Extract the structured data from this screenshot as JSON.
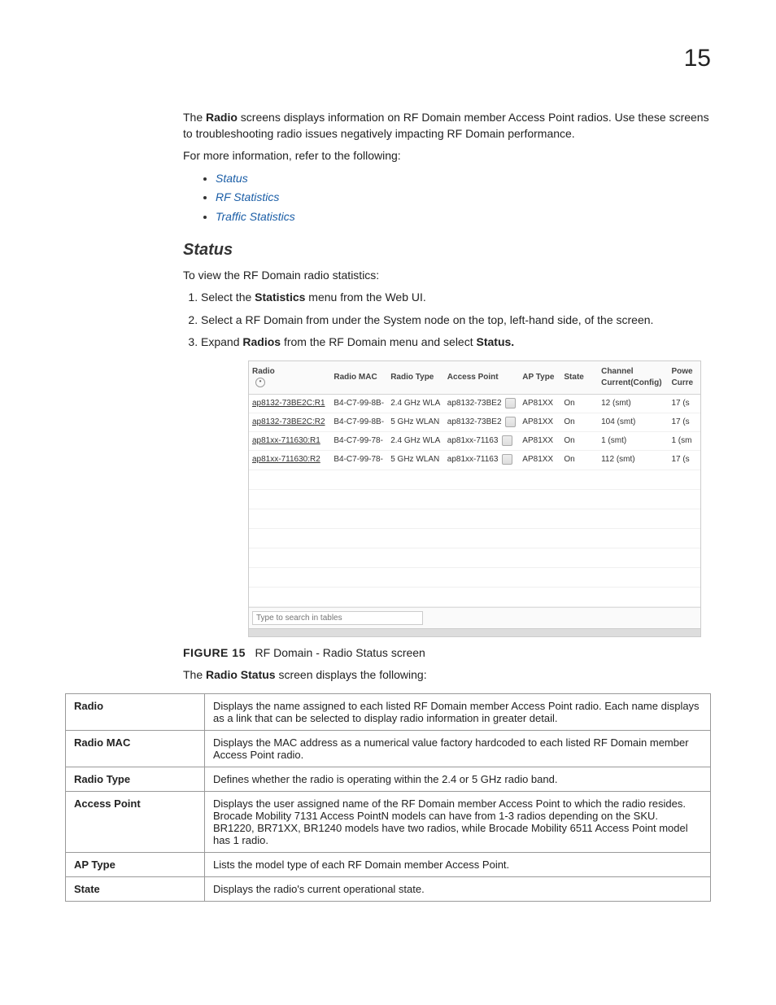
{
  "page_number": "15",
  "intro": {
    "radio_label": "Radio",
    "text1": " screens displays information on RF Domain member Access Point radios. Use these screens to troubleshooting radio issues negatively impacting RF Domain performance.",
    "text2": "For more information, refer to the following:"
  },
  "links": [
    "Status",
    "RF Statistics",
    "Traffic Statistics"
  ],
  "status_heading": "Status",
  "status_intro": "To view the RF Domain radio statistics:",
  "steps": {
    "s1a": "Select the ",
    "s1b": "Statistics",
    "s1c": " menu from the Web UI.",
    "s2": "Select a RF Domain from under the System node on the top, left-hand side, of the screen.",
    "s3a": "Expand ",
    "s3b": "Radios",
    "s3c": " from the RF Domain menu and select ",
    "s3d": "Status.",
    "s3e": ""
  },
  "screenshot": {
    "headers": {
      "radio": "Radio",
      "mac": "Radio MAC",
      "type": "Radio Type",
      "ap": "Access Point",
      "aptype": "AP Type",
      "state": "State",
      "channel": "Channel Current(Config)",
      "power": "Powe Curre"
    },
    "rows": [
      {
        "radio": "ap8132-73BE2C:R1",
        "mac": "B4-C7-99-8B-",
        "type": "2.4 GHz WLA",
        "ap": "ap8132-73BE2",
        "aptype": "AP81XX",
        "state": "On",
        "channel": "12 (smt)",
        "power": "17 (s"
      },
      {
        "radio": "ap8132-73BE2C:R2",
        "mac": "B4-C7-99-8B-",
        "type": "5 GHz WLAN",
        "ap": "ap8132-73BE2",
        "aptype": "AP81XX",
        "state": "On",
        "channel": "104 (smt)",
        "power": "17 (s"
      },
      {
        "radio": "ap81xx-711630:R1",
        "mac": "B4-C7-99-78-",
        "type": "2.4 GHz WLA",
        "ap": "ap81xx-71163",
        "aptype": "AP81XX",
        "state": "On",
        "channel": "1 (smt)",
        "power": "1 (sm"
      },
      {
        "radio": "ap81xx-711630:R2",
        "mac": "B4-C7-99-78-",
        "type": "5 GHz WLAN",
        "ap": "ap81xx-71163",
        "aptype": "AP81XX",
        "state": "On",
        "channel": "112 (smt)",
        "power": "17 (s"
      }
    ],
    "search_placeholder": "Type to search in tables"
  },
  "figure": {
    "label": "FIGURE 15",
    "caption": "RF Domain - Radio Status screen"
  },
  "after_figure": {
    "a": "The ",
    "b": "Radio Status",
    "c": " screen displays the following:"
  },
  "defs": [
    {
      "term": "Radio",
      "desc": "Displays the name assigned to each listed RF Domain member Access Point radio. Each name displays as a link that can be selected to display radio information in greater detail."
    },
    {
      "term": "Radio MAC",
      "desc": "Displays the MAC address as a numerical value factory hardcoded to each listed RF Domain member Access Point radio."
    },
    {
      "term": "Radio Type",
      "desc": "Defines whether the radio is operating within the 2.4 or 5 GHz radio band."
    },
    {
      "term": "Access Point",
      "desc": "Displays the user assigned name of the RF Domain member Access Point to which the radio resides. Brocade Mobility 7131 Access PointN models can have from 1-3 radios depending on the SKU. BR1220, BR71XX, BR1240 models have two radios, while Brocade Mobility 6511 Access Point model has 1 radio."
    },
    {
      "term": "AP Type",
      "desc": "Lists the model type of each RF Domain member Access Point."
    },
    {
      "term": "State",
      "desc": "Displays the radio's current operational state."
    }
  ]
}
